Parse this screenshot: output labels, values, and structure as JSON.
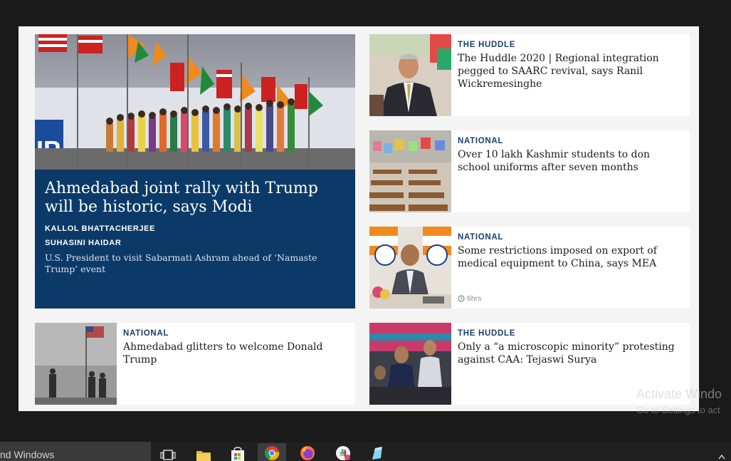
{
  "hero": {
    "title": "Ahmedabad joint rally with Trump will be historic, says Modi",
    "authors": [
      "KALLOL BHATTACHERJEE",
      "SUHASINI HAIDAR"
    ],
    "summary": "U.S. President to visit Sabarmati Ashram ahead of ‘Namaste Trump’ event"
  },
  "cards": [
    {
      "section": "THE HUDDLE",
      "headline": "The Huddle 2020 | Regional integration pegged to SAARC revival, says Ranil Wickremesinghe"
    },
    {
      "section": "NATIONAL",
      "headline": "Over 10 lakh Kashmir students to don school uniforms after seven months"
    },
    {
      "section": "NATIONAL",
      "headline": "Some restrictions imposed on export of medical equipment to China, says MEA",
      "time": "6hrs"
    },
    {
      "section": "NATIONAL",
      "headline": "Ahmedabad glitters to welcome Donald Trump"
    },
    {
      "section": "THE HUDDLE",
      "headline": "Only a “a microscopic minority” protesting against CAA: Tejaswi Surya"
    }
  ],
  "watermark": {
    "line1": "Activate Windo",
    "line2": "Go to Settings to act"
  },
  "taskbar": {
    "search_text": "nd Windows",
    "apps": [
      "task-view-icon",
      "file-explorer-icon",
      "store-icon",
      "chrome-icon",
      "firefox-icon",
      "slack-icon",
      "app-icon"
    ]
  }
}
